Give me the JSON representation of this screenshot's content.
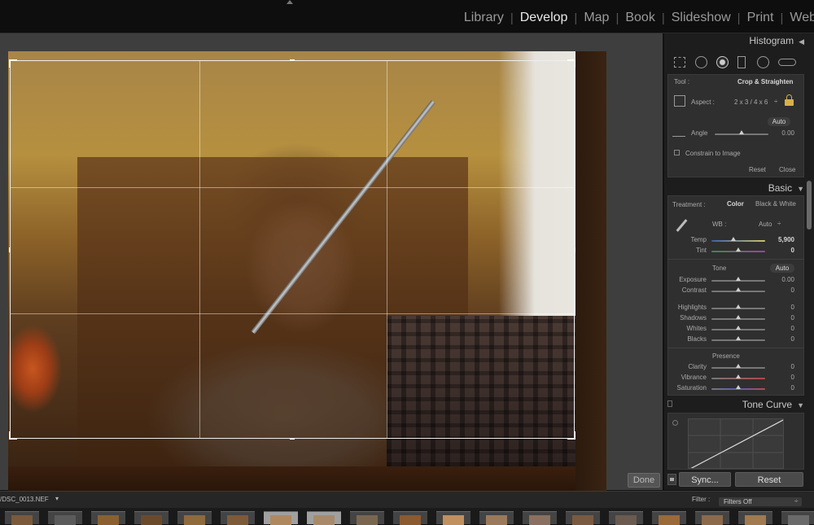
{
  "modules": [
    "Library",
    "Develop",
    "Map",
    "Book",
    "Slideshow",
    "Print",
    "Web"
  ],
  "active_module": "Develop",
  "right_panel": {
    "histogram_title": "Histogram",
    "crop": {
      "tool_label": "Tool :",
      "tool_value": "Crop & Straighten",
      "aspect_label": "Aspect :",
      "aspect_value": "2 x 3  /  4 x 6",
      "auto_label": "Auto",
      "angle_label": "Angle",
      "angle_value": "0.00",
      "constrain_label": "Constrain to Image",
      "reset_label": "Reset",
      "close_label": "Close"
    },
    "basic": {
      "title": "Basic",
      "treatment_label": "Treatment :",
      "color_label": "Color",
      "bw_label": "Black & White",
      "wb_label": "WB :",
      "wb_value": "Auto",
      "temp_label": "Temp",
      "temp_value": "5,900",
      "tint_label": "Tint",
      "tint_value": "0",
      "tone_label": "Tone",
      "tone_auto": "Auto",
      "exposure_label": "Exposure",
      "exposure_value": "0.00",
      "contrast_label": "Contrast",
      "contrast_value": "0",
      "highlights_label": "Highlights",
      "highlights_value": "0",
      "shadows_label": "Shadows",
      "shadows_value": "0",
      "whites_label": "Whites",
      "whites_value": "0",
      "blacks_label": "Blacks",
      "blacks_value": "0",
      "presence_label": "Presence",
      "clarity_label": "Clarity",
      "clarity_value": "0",
      "vibrance_label": "Vibrance",
      "vibrance_value": "0",
      "saturation_label": "Saturation",
      "saturation_value": "0"
    },
    "tone_curve_title": "Tone Curve",
    "sync_label": "Sync...",
    "reset_label": "Reset"
  },
  "center": {
    "done_label": "Done"
  },
  "filmstrip": {
    "path": "/DSC_0013.NEF",
    "filter_label": "Filter :",
    "filter_value": "Filters Off",
    "thumb_count": 19
  },
  "icons": {
    "top_arrow": "triangle-up-icon",
    "collapse": "triangle-left-icon"
  }
}
